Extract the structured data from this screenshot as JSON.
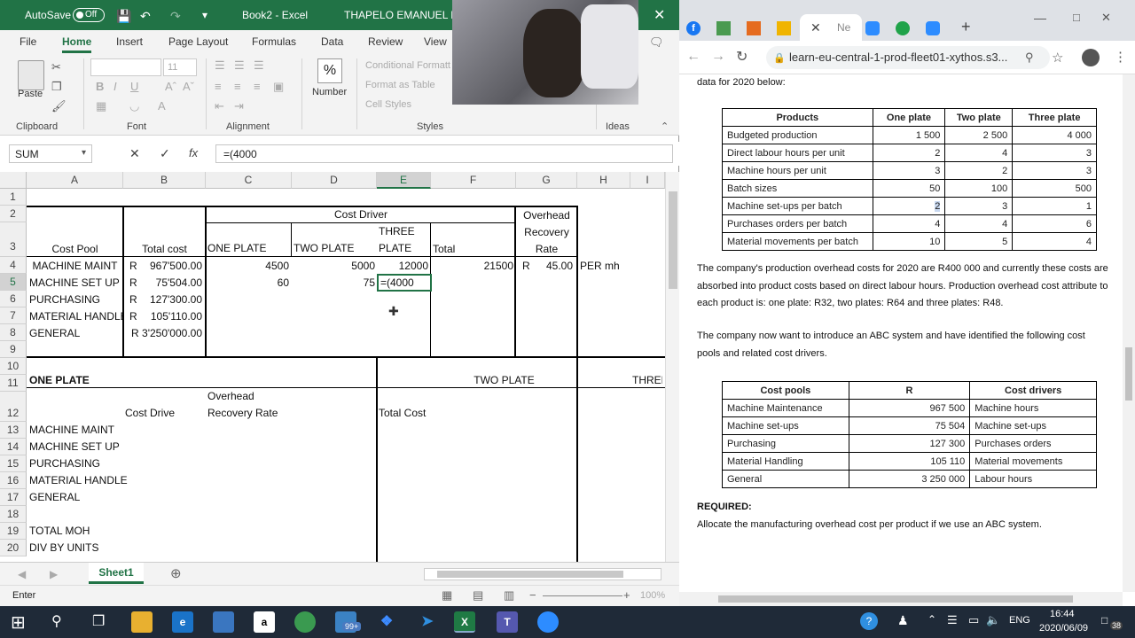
{
  "excel": {
    "autosave_label": "AutoSave",
    "autosave_state": "Off",
    "file_title": "Book2  -  Excel",
    "user_name": "THAPELO EMANUEL MH",
    "tabs": [
      "File",
      "Home",
      "Insert",
      "Page Layout",
      "Formulas",
      "Data",
      "Review",
      "View"
    ],
    "ribbon": {
      "paste": "Paste",
      "clipboard": "Clipboard",
      "font": "Font",
      "font_size": "11",
      "alignment": "Alignment",
      "number": "Number",
      "percent": "%",
      "conditional": "Conditional Formatting",
      "format_table": "Format as Table",
      "cell_styles": "Cell Styles",
      "styles": "Styles",
      "ideas": "Ideas"
    },
    "name_box": "SUM",
    "formula": "=(4000",
    "columns": [
      "A",
      "B",
      "C",
      "D",
      "E",
      "F",
      "G",
      "H",
      "I"
    ],
    "rows": [
      "1",
      "2",
      "3",
      "4",
      "5",
      "6",
      "7",
      "8",
      "9",
      "10",
      "11",
      "12",
      "13",
      "14",
      "15",
      "16",
      "17",
      "18",
      "19",
      "20"
    ],
    "cells": {
      "cost_driver": "Cost Driver",
      "overhead": "Overhead",
      "recovery": "Recovery",
      "rate": "Rate",
      "cost_pool": "Cost Pool",
      "total_cost": "Total cost",
      "one_plate": "ONE PLATE",
      "two_plate": "TWO PLATE",
      "three": "THREE",
      "plate": "PLATE",
      "total": "Total",
      "a4": "MACHINE MAINT",
      "b4r": "R",
      "b4": "967'500.00",
      "c4": "4500",
      "d4": "5000",
      "e4": "12000",
      "f4": "21500",
      "g4r": "R",
      "g4": "45.00",
      "h4": "PER mh",
      "a5": "MACHINE SET UP",
      "b5r": "R",
      "b5": "75'504.00",
      "c5": "60",
      "d5": "75",
      "e5": "=(4000",
      "a6": "PURCHASING",
      "b6r": "R",
      "b6": "127'300.00",
      "a7": "MATERIAL HANDLE",
      "b7r": "R",
      "b7": "105'110.00",
      "a8": "GENERAL",
      "b8": "R 3'250'000.00",
      "a11": "ONE  PLATE",
      "e11": "TWO PLATE",
      "i11": "THREE",
      "c12a": "Overhead",
      "c12b": "Recovery Rate",
      "b12": "Cost Drive",
      "e12": "Total Cost",
      "a13": "MACHINE MAINT",
      "a14": "MACHINE SET UP",
      "a15": "PURCHASING",
      "a16": "MATERIAL HANDLE",
      "a17": "GENERAL",
      "a19": "TOTAL MOH",
      "a20": "DIV BY UNITS"
    },
    "sheet_tab": "Sheet1",
    "status": "Enter",
    "zoom": "100%"
  },
  "browser": {
    "url": "learn-eu-central-1-prod-fleet01-xythos.s3...",
    "tab_label": "Ne",
    "intro": "data for 2020 below:",
    "table1": {
      "headers": [
        "Products",
        "One plate",
        "Two plate",
        "Three plate"
      ],
      "rows": [
        [
          "Budgeted production",
          "1 500",
          "2 500",
          "4 000"
        ],
        [
          "Direct labour hours per unit",
          "2",
          "4",
          "3"
        ],
        [
          "Machine hours per unit",
          "3",
          "2",
          "3"
        ],
        [
          "Batch sizes",
          "50",
          "100",
          "500"
        ],
        [
          "Machine set-ups per batch",
          "2",
          "3",
          "1"
        ],
        [
          "Purchases orders per batch",
          "4",
          "4",
          "6"
        ],
        [
          "Material movements per batch",
          "10",
          "5",
          "4"
        ]
      ]
    },
    "para1": "The company's production overhead costs for 2020 are R400 000 and currently these costs are absorbed into product costs based on direct labour hours.  Production overhead cost attribute to each product is:  one plate:  R32, two plates:  R64 and three plates:  R48.",
    "para2": "The company now want to introduce an ABC system and have identified the following cost pools and related cost drivers.",
    "table2": {
      "headers": [
        "Cost pools",
        "R",
        "Cost drivers"
      ],
      "rows": [
        [
          "Machine Maintenance",
          "967 500",
          "Machine hours"
        ],
        [
          "Machine set-ups",
          "75 504",
          "Machine set-ups"
        ],
        [
          "Purchasing",
          "127 300",
          "Purchases orders"
        ],
        [
          "Material Handling",
          "105 110",
          "Material movements"
        ],
        [
          "General",
          "3 250 000",
          "Labour hours"
        ]
      ]
    },
    "required": "REQUIRED:",
    "task": "Allocate the manufacturing overhead cost per product if we use an ABC system."
  },
  "taskbar": {
    "time": "16:44",
    "date": "2020/06/09",
    "lang": "ENG",
    "badge": "99+",
    "notif": "38"
  }
}
